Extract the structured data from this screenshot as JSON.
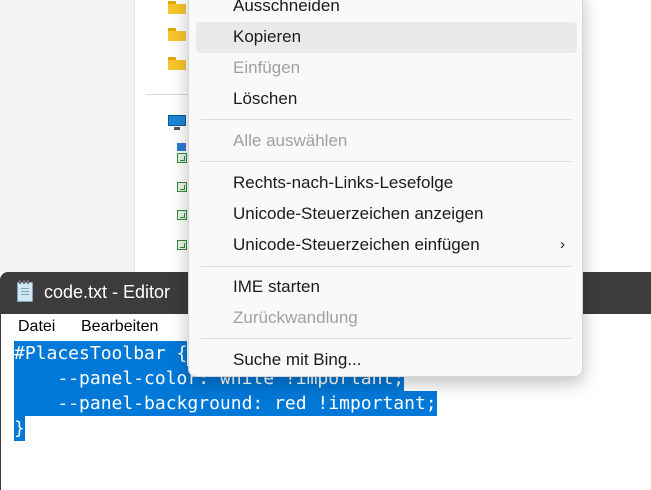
{
  "notepad": {
    "title": "code.txt - Editor",
    "menu": [
      "Datei",
      "Bearbeiten"
    ],
    "code_lines": [
      "#PlacesToolbar {",
      "    --panel-color: white !important;",
      "    --panel-background: red !important;",
      "}"
    ]
  },
  "context_menu": {
    "items": [
      {
        "label": "Ausschneiden",
        "state": "enabled"
      },
      {
        "label": "Kopieren",
        "state": "hovered"
      },
      {
        "label": "Einfügen",
        "state": "disabled"
      },
      {
        "label": "Löschen",
        "state": "enabled"
      },
      {
        "label": "Alle auswählen",
        "state": "disabled"
      },
      {
        "label": "Rechts-nach-Links-Lesefolge",
        "state": "enabled"
      },
      {
        "label": "Unicode-Steuerzeichen anzeigen",
        "state": "enabled"
      },
      {
        "label": "Unicode-Steuerzeichen einfügen",
        "state": "enabled",
        "submenu": true,
        "arrow": "›"
      },
      {
        "label": "IME starten",
        "state": "enabled"
      },
      {
        "label": "Zurückwandlung",
        "state": "disabled"
      },
      {
        "label": "Suche mit Bing...",
        "state": "enabled"
      }
    ]
  },
  "icons": {
    "folder": "folder-icon",
    "this_pc": "this-pc-icon",
    "notepad": "notepad-app-icon",
    "submenu": "chevron-right-icon"
  },
  "colors": {
    "selection": "#0078d7",
    "titlebar": "#3c3c3c",
    "menu_background": "#f9f9f9",
    "disabled_text": "#a0a0a0"
  }
}
